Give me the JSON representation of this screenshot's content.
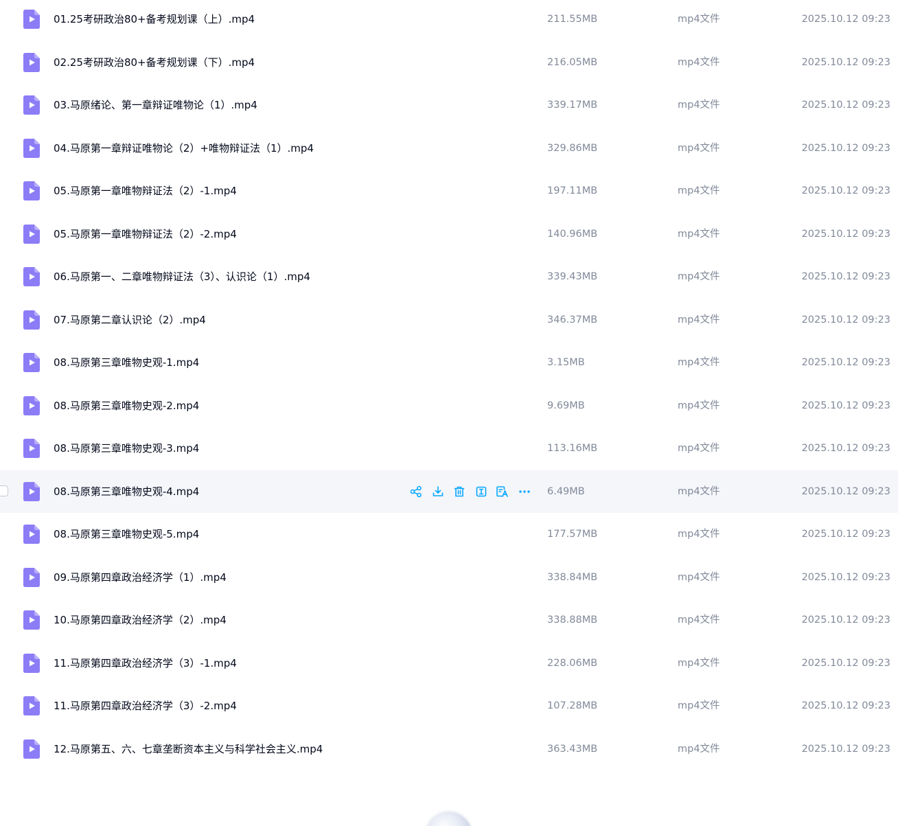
{
  "file_type_icon": "video-file-icon",
  "colors": {
    "icon_purple": "#8c7cf6",
    "action_blue": "#06a7ff",
    "row_hover": "#f5f6fa",
    "name_text": "#03081a",
    "meta_text": "#818999"
  },
  "row_actions": [
    "share-icon",
    "download-icon",
    "delete-icon",
    "rename-icon",
    "ai-text-icon",
    "more-icon"
  ],
  "files": [
    {
      "name": "01.25考研政治80+备考规划课（上）.mp4",
      "size": "211.55MB",
      "type": "mp4文件",
      "date": "2025.10.12 09:23"
    },
    {
      "name": "02.25考研政治80+备考规划课（下）.mp4",
      "size": "216.05MB",
      "type": "mp4文件",
      "date": "2025.10.12 09:23"
    },
    {
      "name": "03.马原绪论、第一章辩证唯物论（1）.mp4",
      "size": "339.17MB",
      "type": "mp4文件",
      "date": "2025.10.12 09:23"
    },
    {
      "name": "04.马原第一章辩证唯物论（2）+唯物辩证法（1）.mp4",
      "size": "329.86MB",
      "type": "mp4文件",
      "date": "2025.10.12 09:23"
    },
    {
      "name": "05.马原第一章唯物辩证法（2）-1.mp4",
      "size": "197.11MB",
      "type": "mp4文件",
      "date": "2025.10.12 09:23"
    },
    {
      "name": "05.马原第一章唯物辩证法（2）-2.mp4",
      "size": "140.96MB",
      "type": "mp4文件",
      "date": "2025.10.12 09:23"
    },
    {
      "name": "06.马原第一、二章唯物辩证法（3）、认识论（1）.mp4",
      "size": "339.43MB",
      "type": "mp4文件",
      "date": "2025.10.12 09:23"
    },
    {
      "name": "07.马原第二章认识论（2）.mp4",
      "size": "346.37MB",
      "type": "mp4文件",
      "date": "2025.10.12 09:23"
    },
    {
      "name": "08.马原第三章唯物史观-1.mp4",
      "size": "3.15MB",
      "type": "mp4文件",
      "date": "2025.10.12 09:23"
    },
    {
      "name": "08.马原第三章唯物史观-2.mp4",
      "size": "9.69MB",
      "type": "mp4文件",
      "date": "2025.10.12 09:23"
    },
    {
      "name": "08.马原第三章唯物史观-3.mp4",
      "size": "113.16MB",
      "type": "mp4文件",
      "date": "2025.10.12 09:23"
    },
    {
      "name": "08.马原第三章唯物史观-4.mp4",
      "size": "6.49MB",
      "type": "mp4文件",
      "date": "2025.10.12 09:23",
      "hovered": true
    },
    {
      "name": "08.马原第三章唯物史观-5.mp4",
      "size": "177.57MB",
      "type": "mp4文件",
      "date": "2025.10.12 09:23"
    },
    {
      "name": "09.马原第四章政治经济学（1）.mp4",
      "size": "338.84MB",
      "type": "mp4文件",
      "date": "2025.10.12 09:23"
    },
    {
      "name": "10.马原第四章政治经济学（2）.mp4",
      "size": "338.88MB",
      "type": "mp4文件",
      "date": "2025.10.12 09:23"
    },
    {
      "name": "11.马原第四章政治经济学（3）-1.mp4",
      "size": "228.06MB",
      "type": "mp4文件",
      "date": "2025.10.12 09:23"
    },
    {
      "name": "11.马原第四章政治经济学（3）-2.mp4",
      "size": "107.28MB",
      "type": "mp4文件",
      "date": "2025.10.12 09:23"
    },
    {
      "name": "12.马原第五、六、七章垄断资本主义与科学社会主义.mp4",
      "size": "363.43MB",
      "type": "mp4文件",
      "date": "2025.10.12 09:23"
    }
  ]
}
